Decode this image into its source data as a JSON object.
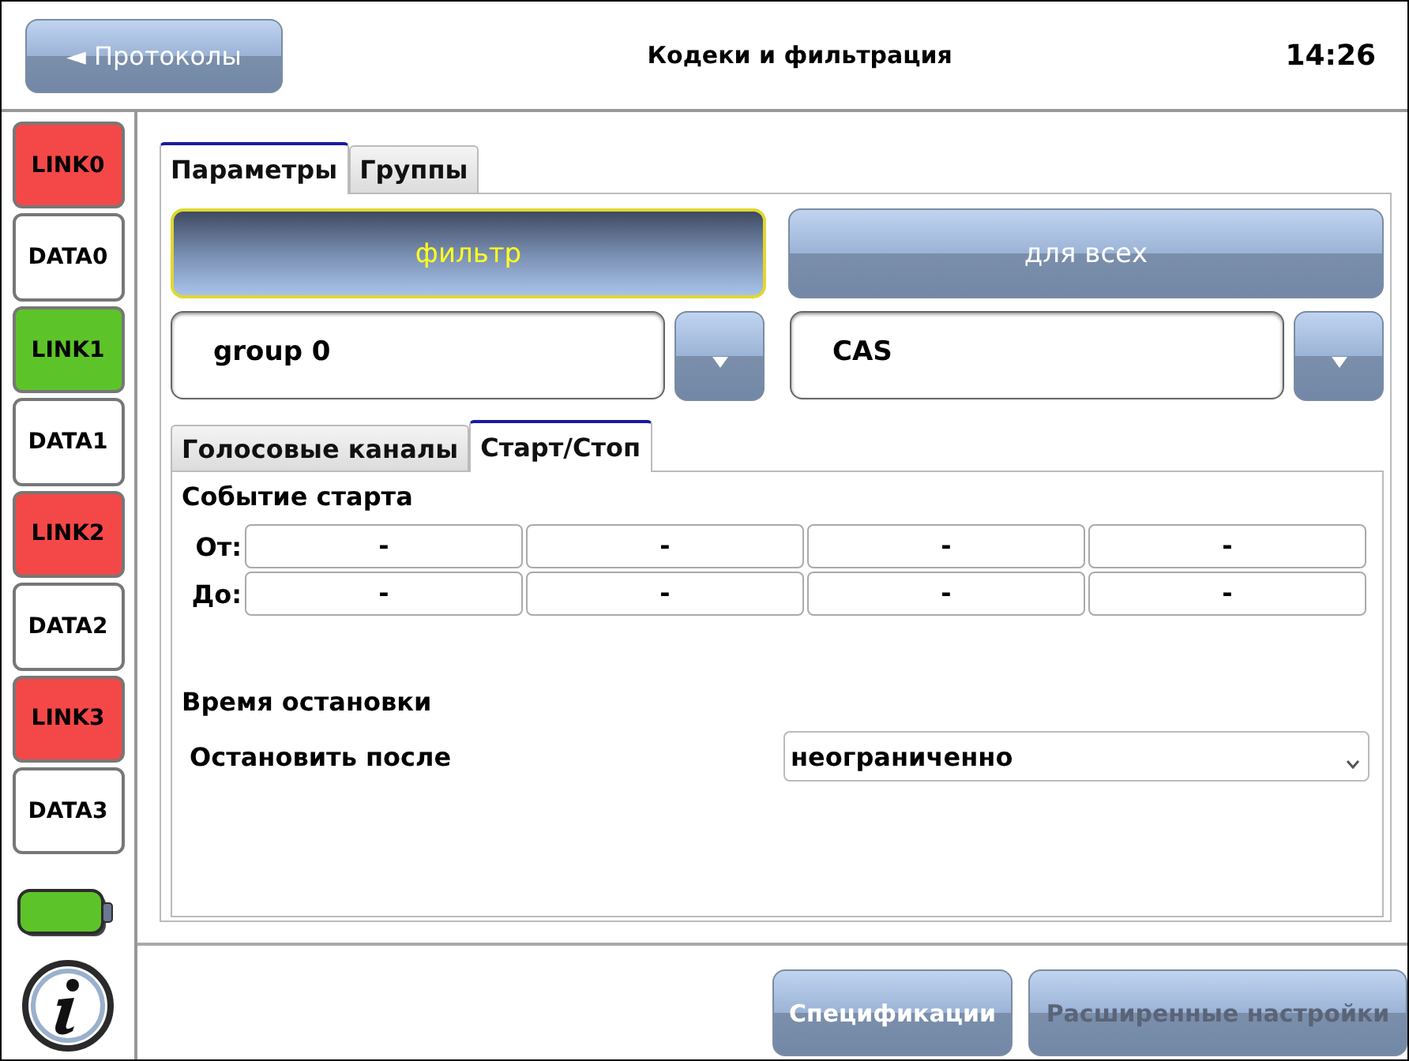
{
  "header": {
    "back_button": "◄ Протоколы",
    "title": "Кодеки и фильтрация",
    "time": "14:26"
  },
  "sidebar": {
    "items": [
      {
        "label": "LINK0",
        "color": "#f44848"
      },
      {
        "label": "DATA0",
        "color": "#ffffff"
      },
      {
        "label": "LINK1",
        "color": "#5cc428"
      },
      {
        "label": "DATA1",
        "color": "#ffffff"
      },
      {
        "label": "LINK2",
        "color": "#f44848"
      },
      {
        "label": "DATA2",
        "color": "#ffffff"
      },
      {
        "label": "LINK3",
        "color": "#f44848"
      },
      {
        "label": "DATA3",
        "color": "#ffffff"
      }
    ]
  },
  "tabs": [
    {
      "label": "Параметры",
      "selected": true
    },
    {
      "label": "Группы",
      "selected": false
    }
  ],
  "mode_buttons": [
    {
      "label": "фильтр",
      "selected": true
    },
    {
      "label": "для всех",
      "selected": false
    }
  ],
  "selectors": [
    {
      "value": "group 0"
    },
    {
      "value": "CAS"
    }
  ],
  "subtabs": [
    {
      "label": "Голосовые каналы",
      "selected": false
    },
    {
      "label": "Старт/Стоп",
      "selected": true
    }
  ],
  "start_event": {
    "title": "Событие старта",
    "rows": [
      {
        "label": "От:",
        "cells": [
          "-",
          "-",
          "-",
          "-"
        ]
      },
      {
        "label": "До:",
        "cells": [
          "-",
          "-",
          "-",
          "-"
        ]
      }
    ]
  },
  "stop_time": {
    "title": "Время остановки",
    "label": "Остановить после",
    "value": "неограниченно"
  },
  "footer_buttons": [
    {
      "label": "Спецификации",
      "disabled": false
    },
    {
      "label": "Расширенные настройки",
      "disabled": true
    }
  ]
}
